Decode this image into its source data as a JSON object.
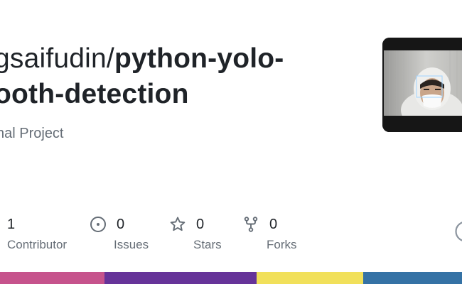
{
  "repo": {
    "owner_text": "gsaifudin",
    "separator": "/",
    "name_line1": "python-yolo-",
    "name_line2": "ooth-detection",
    "description": "nal Project"
  },
  "stats": {
    "contributors": {
      "count": "1",
      "label": "Contributor",
      "icon": "people-icon"
    },
    "issues": {
      "count": "0",
      "label": "Issues",
      "icon": "issue-opened-icon"
    },
    "stars": {
      "count": "0",
      "label": "Stars",
      "icon": "star-icon"
    },
    "forks": {
      "count": "0",
      "label": "Forks",
      "icon": "repo-forked-icon"
    }
  },
  "language_bar": [
    {
      "color": "#c6538c",
      "share": 0.226
    },
    {
      "color": "#663399",
      "share": 0.33
    },
    {
      "color": "#f1e05a",
      "share": 0.23
    },
    {
      "color": "#3572a5",
      "share": 0.214
    }
  ],
  "colors": {
    "title": "#1f2328",
    "muted": "#656d76"
  },
  "thumbnail": {
    "icon": "webcam-face-detection-image"
  },
  "brand": {
    "icon": "github-mark-icon"
  }
}
